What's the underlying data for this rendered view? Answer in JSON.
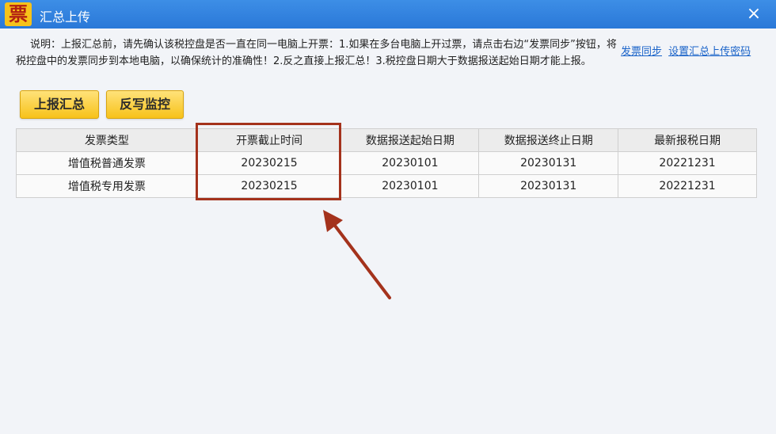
{
  "window": {
    "logo_text": "票",
    "title": "汇总上传",
    "close_glyph": "×"
  },
  "notice": {
    "text": "说明：上报汇总前，请先确认该税控盘是否一直在同一电脑上开票：1.如果在多台电脑上开过票，请点击右边“发票同步”按钮，将税控盘中的发票同步到本地电脑，以确保统计的准确性！2.反之直接上报汇总！3.税控盘日期大于数据报送起始日期才能上报。"
  },
  "links": {
    "invoice_sync": "发票同步",
    "set_password": "设置汇总上传密码"
  },
  "buttons": {
    "submit_summary": "上报汇总",
    "write_back_monitor": "反写监控"
  },
  "table": {
    "headers": [
      "发票类型",
      "开票截止时间",
      "数据报送起始日期",
      "数据报送终止日期",
      "最新报税日期"
    ],
    "rows": [
      [
        "增值税普通发票",
        "20230215",
        "20230101",
        "20230131",
        "20221231"
      ],
      [
        "增值税专用发票",
        "20230215",
        "20230101",
        "20230131",
        "20221231"
      ]
    ]
  },
  "colors": {
    "titlebar": "#2a78d8",
    "button": "#f7c21a",
    "annotation": "#a4321c",
    "link": "#1a63c9"
  }
}
